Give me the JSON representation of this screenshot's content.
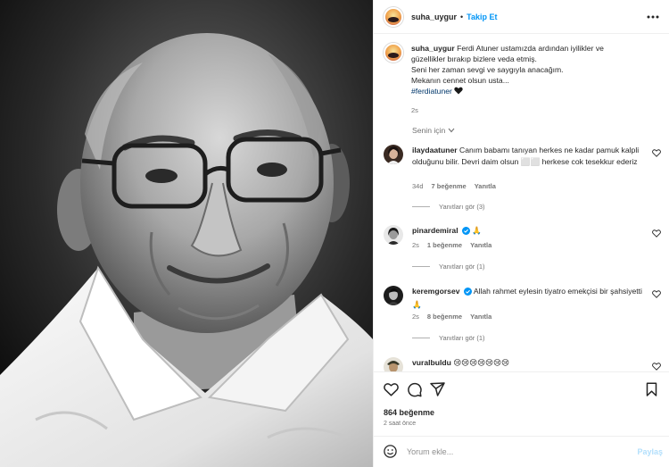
{
  "post": {
    "username": "suha_uygur",
    "separator": "•",
    "follow_label": "Takip Et",
    "more_icon": "more-horizontal-icon"
  },
  "caption": {
    "username": "suha_uygur",
    "lines": [
      "Ferdi Atuner ustamızda ardından iyilikler ve",
      "güzellikler bırakıp bizlere veda etmiş.",
      "Seni her zaman sevgi ve saygıyla anacağım.",
      "Mekanın cennet olsun usta..."
    ],
    "hashtag": "#ferdiatuner",
    "emoji": "black-heart-icon",
    "time": "2s"
  },
  "filter": {
    "label": "Senin için",
    "icon": "chevron-down-icon"
  },
  "comments": [
    {
      "username": "ilaydaatuner",
      "verified": false,
      "text": "Canım babamı tanıyan herkes ne kadar pamuk kalpli olduğunu bilir. Devri daim olsun ⬜⬜ herkese cok tesekkur ederiz",
      "time": "34d",
      "likes": "7 beğenme",
      "reply_label": "Yanıtla",
      "view_replies": "Yanıtları gör (3)"
    },
    {
      "username": "pinardemiral",
      "verified": true,
      "text": "🙏",
      "time": "2s",
      "likes": "1 beğenme",
      "reply_label": "Yanıtla",
      "view_replies": "Yanıtları gör (1)"
    },
    {
      "username": "keremgorsev",
      "verified": true,
      "text": "Allah rahmet eylesin tiyatro emekçisi bir şahsiyetti 🙏",
      "time": "2s",
      "likes": "8 beğenme",
      "reply_label": "Yanıtla",
      "view_replies": "Yanıtları gör (1)"
    },
    {
      "username": "vuralbuldu",
      "verified": false,
      "text": "😢😢😢😢😢😢😢",
      "time": "",
      "likes": "",
      "reply_label": "",
      "view_replies": ""
    }
  ],
  "actions": {
    "like_icon": "heart-outline-icon",
    "comment_icon": "comment-icon",
    "share_icon": "send-icon",
    "save_icon": "bookmark-icon",
    "likes_count": "864 beğenme",
    "posted_time": "2 saat önce"
  },
  "add_comment": {
    "emoji_icon": "emoji-smile-icon",
    "placeholder": "Yorum ekle...",
    "post_label": "Paylaş"
  },
  "colors": {
    "link_blue": "#0095f6",
    "hashtag_blue": "#00376b",
    "secondary_text": "#737373",
    "border": "#efefef",
    "verified_blue": "#0095f6",
    "post_disabled": "#b2dffc"
  }
}
